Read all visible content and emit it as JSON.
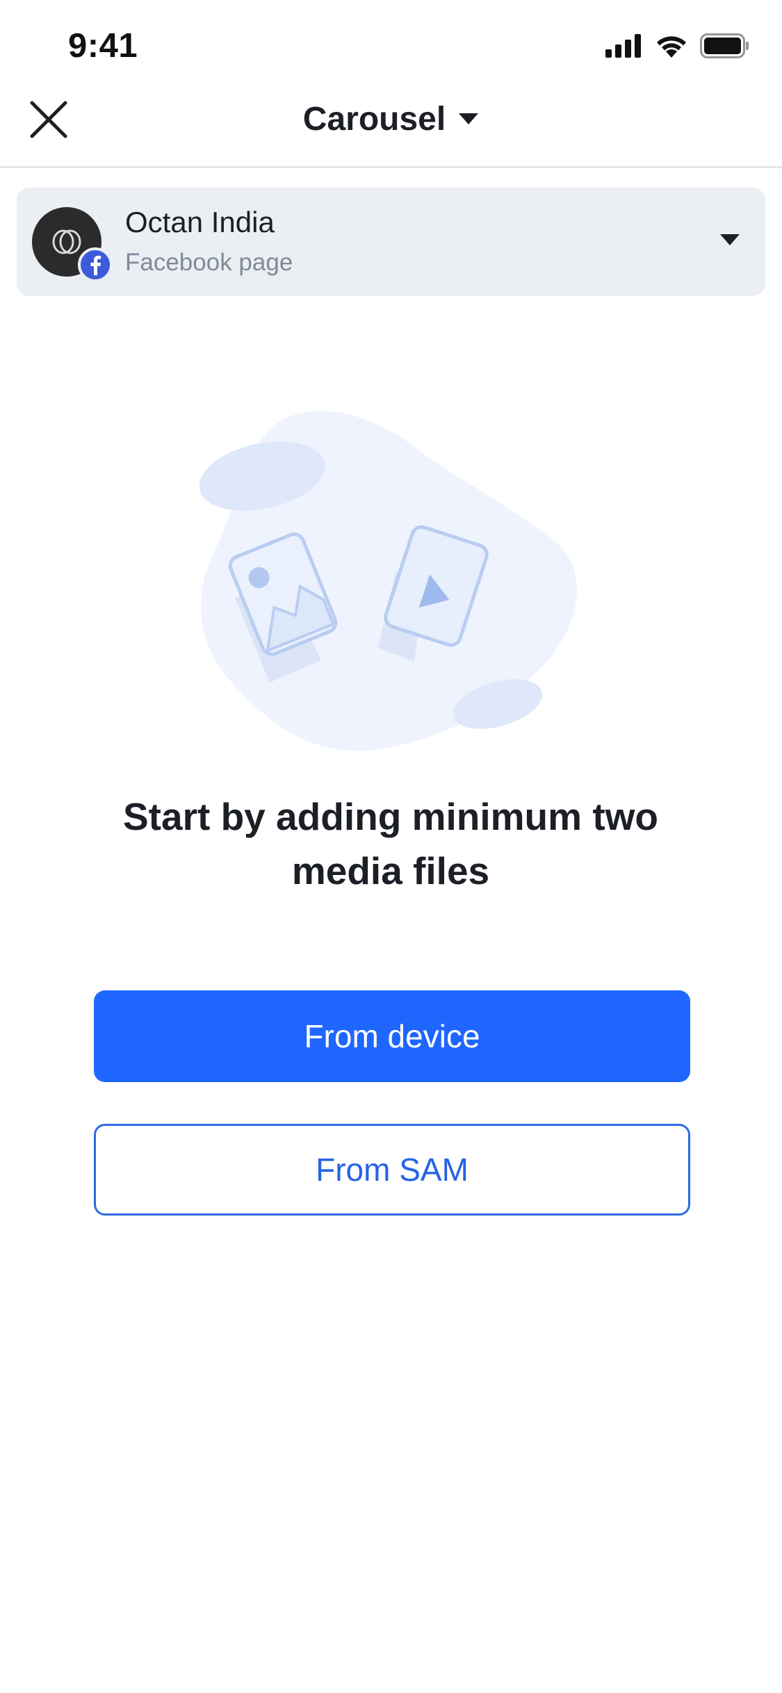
{
  "status_bar": {
    "time": "9:41",
    "icons": [
      "cellular-signal-icon",
      "wifi-icon",
      "battery-icon"
    ]
  },
  "header": {
    "title": "Carousel",
    "close_icon": "close-icon",
    "title_dropdown_icon": "caret-down-icon"
  },
  "account": {
    "name": "Octan India",
    "type": "Facebook page",
    "badge_icon": "facebook-icon",
    "dropdown_icon": "caret-down-icon"
  },
  "empty_state": {
    "illustration": "media-files-illustration",
    "headline_line1": "Start by adding minimum two",
    "headline_line2": "media files"
  },
  "actions": {
    "primary_label": "From device",
    "secondary_label": "From SAM"
  },
  "colors": {
    "primary": "#1f66ff",
    "secondary_border": "#2d6ae3",
    "card_background": "#ebeef2",
    "muted_text": "#7f8b9b",
    "illustration_blob": "#eef3fd"
  }
}
